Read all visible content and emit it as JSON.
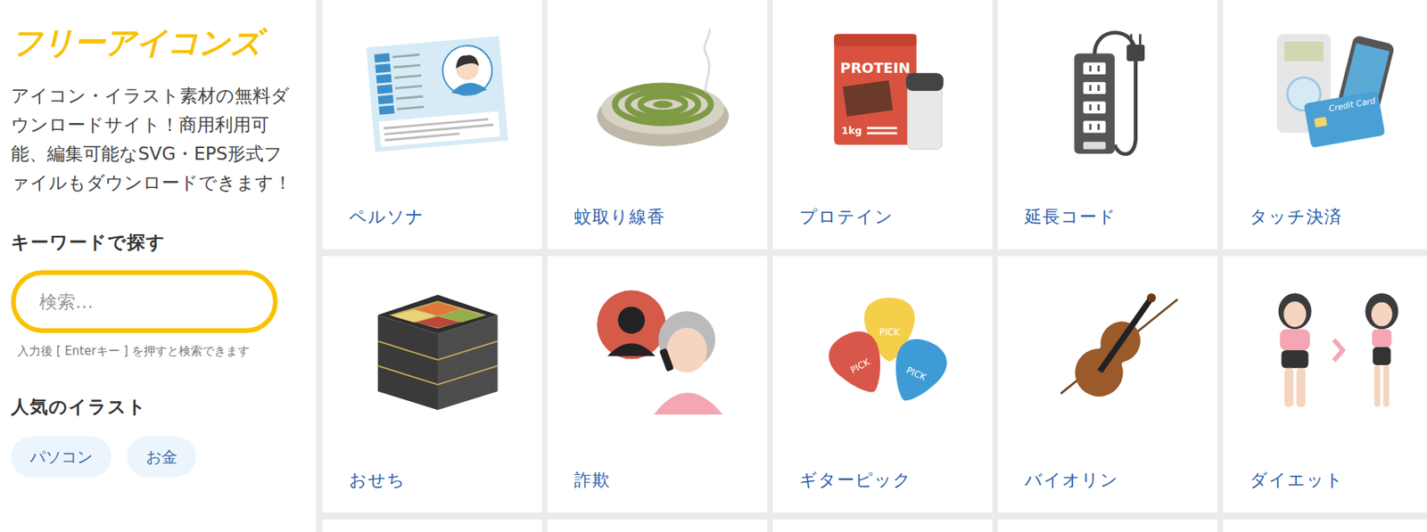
{
  "sidebar": {
    "logo": "フリーアイコンズ",
    "description": "アイコン・イラスト素材の無料ダウンロードサイト！商用利用可能、編集可能なSVG・EPS形式ファイルもダウンロードできます！",
    "search": {
      "heading": "キーワードで探す",
      "placeholder": "検索…",
      "hint": "入力後 [ Enterキー ] を押すと検索できます"
    },
    "popular": {
      "heading": "人気のイラスト",
      "tags": [
        "パソコン",
        "お金"
      ]
    }
  },
  "cards": [
    {
      "label": "ペルソナ",
      "texts": []
    },
    {
      "label": "蚊取り線香",
      "texts": []
    },
    {
      "label": "プロテイン",
      "texts": [
        "PROTEIN",
        "1kg"
      ]
    },
    {
      "label": "延長コード",
      "texts": []
    },
    {
      "label": "タッチ決済",
      "texts": [
        "Credit Card"
      ]
    },
    {
      "label": "おせち",
      "texts": []
    },
    {
      "label": "詐欺",
      "texts": []
    },
    {
      "label": "ギターピック",
      "texts": [
        "PICK",
        "PICK",
        "PICK"
      ]
    },
    {
      "label": "バイオリン",
      "texts": []
    },
    {
      "label": "ダイエット",
      "texts": []
    }
  ]
}
